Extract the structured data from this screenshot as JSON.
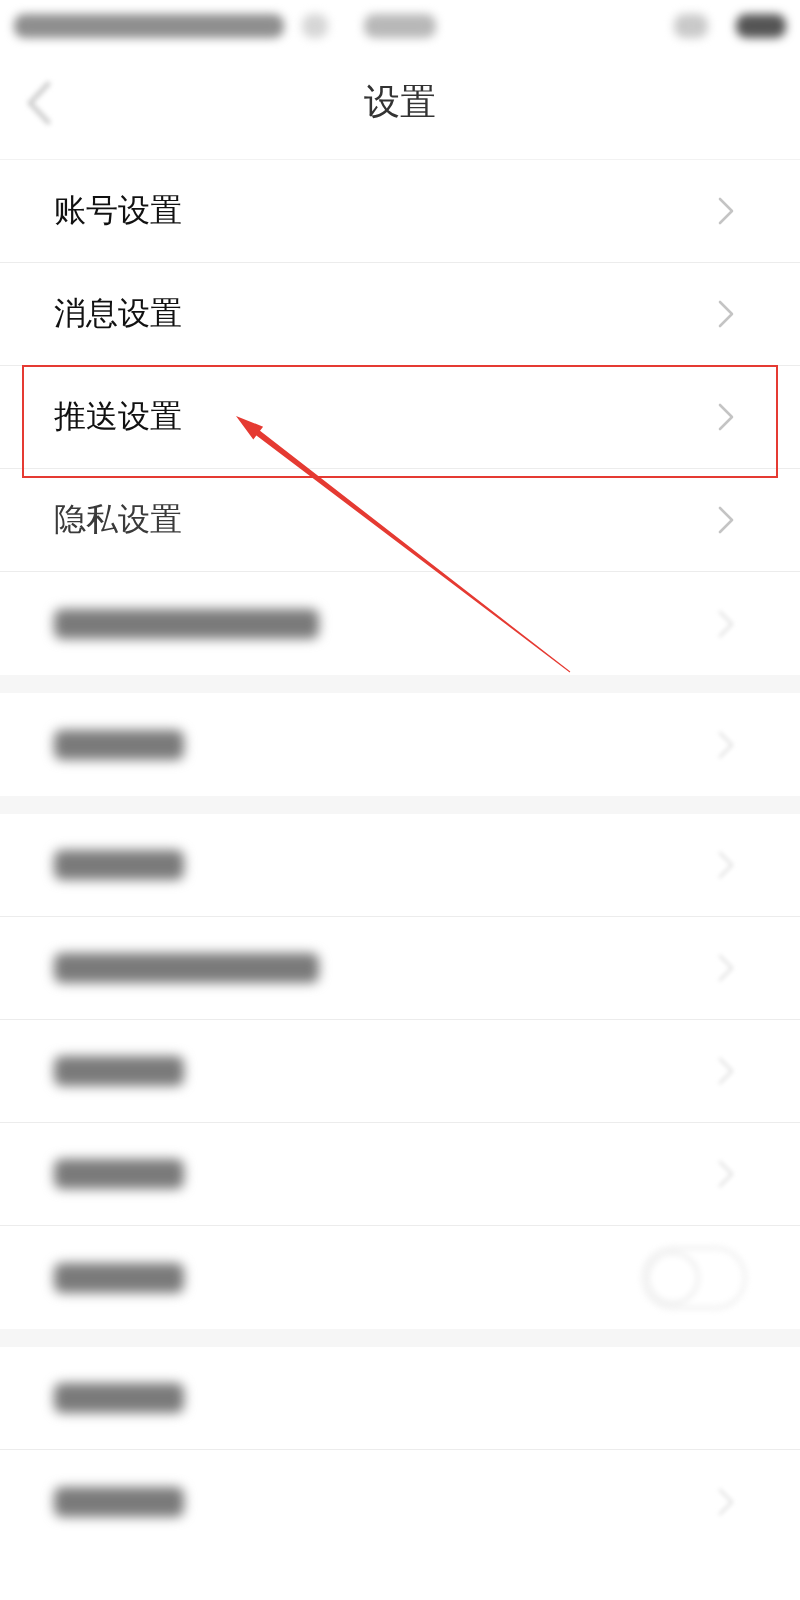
{
  "header": {
    "title": "设置"
  },
  "sections": [
    {
      "items": [
        {
          "kind": "link",
          "label": "账号设置",
          "faded": false,
          "highlighted": false
        },
        {
          "kind": "link",
          "label": "消息设置",
          "faded": false,
          "highlighted": false
        },
        {
          "kind": "link",
          "label": "推送设置",
          "faded": false,
          "highlighted": true
        },
        {
          "kind": "link",
          "label": "隐私设置",
          "faded": true,
          "highlighted": false
        },
        {
          "kind": "blurred",
          "wide": true,
          "chevron": true
        }
      ]
    },
    {
      "items": [
        {
          "kind": "blurred",
          "wide": false,
          "chevron": true
        }
      ]
    },
    {
      "items": [
        {
          "kind": "blurred",
          "wide": false,
          "chevron": true
        },
        {
          "kind": "blurred",
          "wide": true,
          "chevron": true
        },
        {
          "kind": "blurred",
          "wide": false,
          "chevron": true
        },
        {
          "kind": "blurred",
          "wide": false,
          "chevron": true
        },
        {
          "kind": "switch",
          "wide": false,
          "on": false
        }
      ]
    },
    {
      "items": [
        {
          "kind": "blurred",
          "wide": false,
          "chevron": false
        },
        {
          "kind": "blurred",
          "wide": false,
          "chevron": true
        }
      ]
    }
  ]
}
